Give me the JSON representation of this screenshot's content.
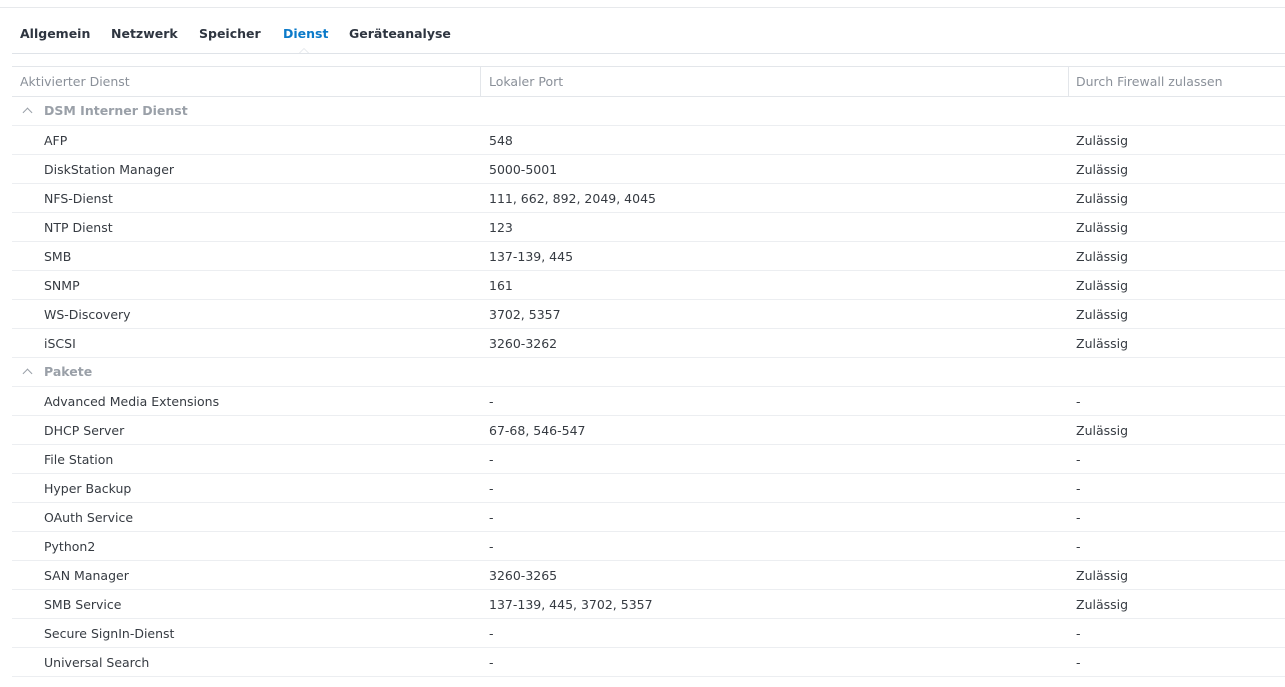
{
  "tabs": [
    {
      "label": "Allgemein",
      "active": false
    },
    {
      "label": "Netzwerk",
      "active": false
    },
    {
      "label": "Speicher",
      "active": false
    },
    {
      "label": "Dienst",
      "active": true
    },
    {
      "label": "Geräteanalyse",
      "active": false
    }
  ],
  "table": {
    "headers": {
      "service": "Aktivierter Dienst",
      "port": "Lokaler Port",
      "firewall": "Durch Firewall zulassen"
    },
    "groups": [
      {
        "label": "DSM Interner Dienst",
        "rows": [
          {
            "service": "AFP",
            "port": "548",
            "firewall": "Zulässig"
          },
          {
            "service": "DiskStation Manager",
            "port": "5000-5001",
            "firewall": "Zulässig"
          },
          {
            "service": "NFS-Dienst",
            "port": "111, 662, 892, 2049, 4045",
            "firewall": "Zulässig"
          },
          {
            "service": "NTP Dienst",
            "port": "123",
            "firewall": "Zulässig"
          },
          {
            "service": "SMB",
            "port": "137-139, 445",
            "firewall": "Zulässig"
          },
          {
            "service": "SNMP",
            "port": "161",
            "firewall": "Zulässig"
          },
          {
            "service": "WS-Discovery",
            "port": "3702, 5357",
            "firewall": "Zulässig"
          },
          {
            "service": "iSCSI",
            "port": "3260-3262",
            "firewall": "Zulässig"
          }
        ]
      },
      {
        "label": "Pakete",
        "rows": [
          {
            "service": "Advanced Media Extensions",
            "port": "-",
            "firewall": "-"
          },
          {
            "service": "DHCP Server",
            "port": "67-68, 546-547",
            "firewall": "Zulässig"
          },
          {
            "service": "File Station",
            "port": "-",
            "firewall": "-"
          },
          {
            "service": "Hyper Backup",
            "port": "-",
            "firewall": "-"
          },
          {
            "service": "OAuth Service",
            "port": "-",
            "firewall": "-"
          },
          {
            "service": "Python2",
            "port": "-",
            "firewall": "-"
          },
          {
            "service": "SAN Manager",
            "port": "3260-3265",
            "firewall": "Zulässig"
          },
          {
            "service": "SMB Service",
            "port": "137-139, 445, 3702, 5357",
            "firewall": "Zulässig"
          },
          {
            "service": "Secure SignIn-Dienst",
            "port": "-",
            "firewall": "-"
          },
          {
            "service": "Universal Search",
            "port": "-",
            "firewall": "-"
          }
        ]
      }
    ]
  }
}
